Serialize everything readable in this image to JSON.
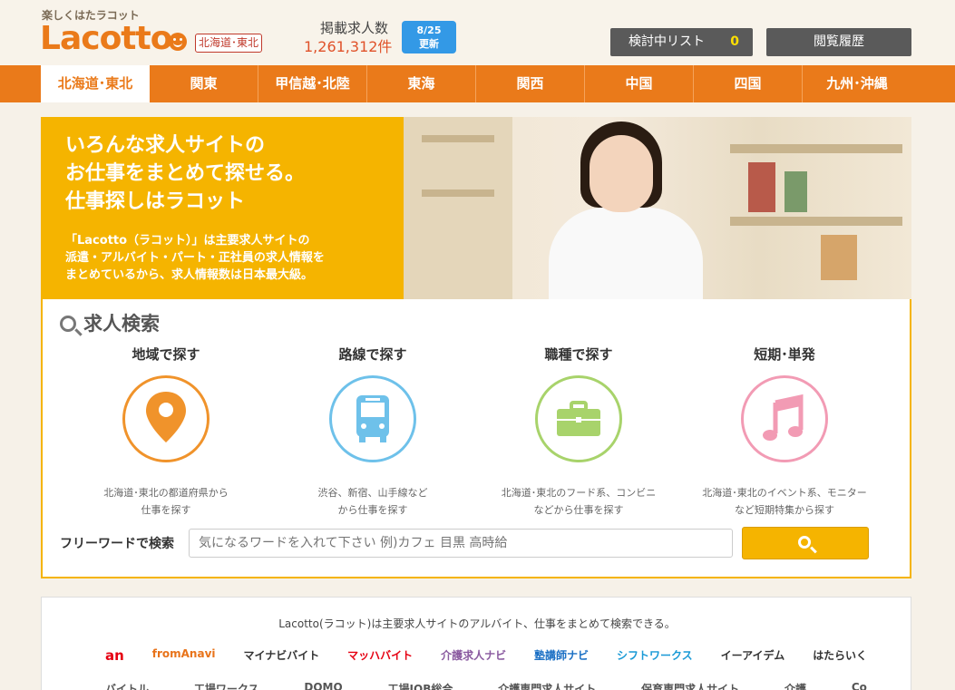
{
  "header": {
    "tagline": "楽しくはたラコット",
    "logo": "Lacotto",
    "region": "北海道･東北",
    "count_label": "掲載求人数",
    "count_value": "1,261,312件",
    "update_date": "8/25",
    "update_label": "更新",
    "list_button": "検討中リスト",
    "list_count": "0",
    "history_button": "閲覧履歴"
  },
  "nav": [
    "北海道･東北",
    "関東",
    "甲信越･北陸",
    "東海",
    "関西",
    "中国",
    "四国",
    "九州･沖縄"
  ],
  "hero": {
    "title_lines": [
      "いろんな求人サイトの",
      "お仕事をまとめて探せる。",
      "仕事探しはラコット"
    ],
    "desc_lines": [
      "「Lacotto（ラコット）」は主要求人サイトの",
      "派遣・アルバイト・パート・正社員の求人情報を",
      "まとめているから、求人情報数は日本最大級。"
    ]
  },
  "search": {
    "heading": "求人検索",
    "categories": [
      {
        "title": "地域で探す",
        "desc1": "北海道･東北の都道府県から",
        "desc2": "仕事を探す",
        "icon": "map-pin-icon",
        "color": "#f0932b"
      },
      {
        "title": "路線で探す",
        "desc1": "渋谷、新宿、山手線など",
        "desc2": "から仕事を探す",
        "icon": "bus-icon",
        "color": "#6ec1ea"
      },
      {
        "title": "職種で探す",
        "desc1": "北海道･東北のフード系、コンビニ",
        "desc2": "などから仕事を探す",
        "icon": "briefcase-icon",
        "color": "#a8d36b"
      },
      {
        "title": "短期･単発",
        "desc1": "北海道･東北のイベント系、モニター",
        "desc2": "など短期特集から探す",
        "icon": "music-note-icon",
        "color": "#f29bb4"
      }
    ],
    "freeword_label": "フリーワードで検索",
    "freeword_placeholder": "気になるワードを入れて下さい 例)カフェ 目黒 高時給"
  },
  "bottom": {
    "text": "Lacotto(ラコット)は主要求人サイトのアルバイト、仕事をまとめて検索できる。",
    "logos": [
      "an",
      "fromAnavi",
      "マイナビバイト",
      "マッハバイト",
      "介護求人ナビ",
      "塾講師ナビ",
      "シフトワークス",
      "イーアイデム",
      "はたらいく"
    ],
    "logos2": [
      "バイトル",
      "工場ワークス",
      "DOMO",
      "工場JOB総合",
      "介護専門求人サイト",
      "保育専門求人サイト",
      "介護",
      "Co"
    ]
  }
}
